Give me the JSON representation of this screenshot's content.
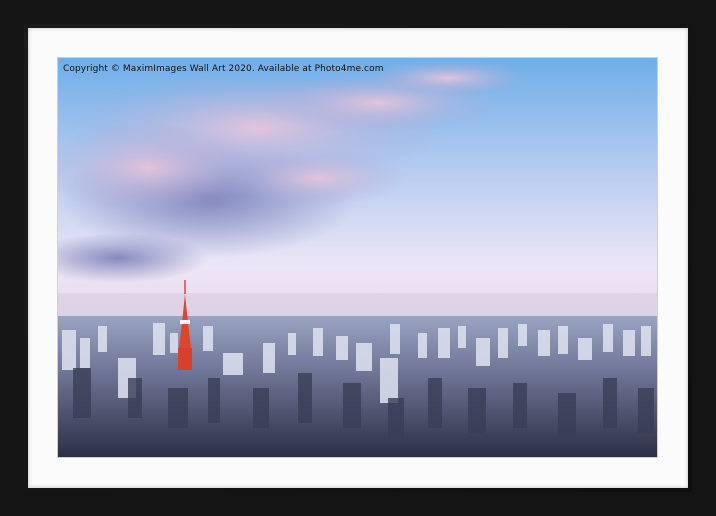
{
  "watermark": {
    "text": "Copyright © MaximImages Wall Art 2020. Available at Photo4me.com"
  },
  "colors": {
    "frame": "#141414",
    "mount": "#fbfbfb",
    "sky_top": "#7fb2e6",
    "sky_bottom": "#f2e8f6",
    "tower": "#e0452a"
  },
  "scene": {
    "subject": "city-skyline-with-tower",
    "elements": [
      "sky",
      "clouds",
      "horizon",
      "bay",
      "buildings",
      "tower"
    ]
  }
}
